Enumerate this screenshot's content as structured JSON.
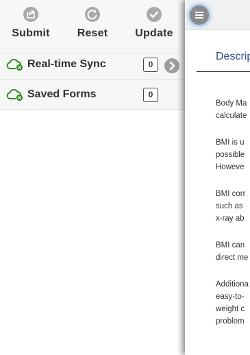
{
  "toolbar": {
    "buttons": [
      {
        "label": "Submit",
        "icon": "share-icon"
      },
      {
        "label": "Reset",
        "icon": "refresh-icon"
      },
      {
        "label": "Update",
        "icon": "checkmark-icon"
      }
    ]
  },
  "list": {
    "items": [
      {
        "label": "Real-time Sync",
        "count": "0",
        "icon": "cloud-sync-icon",
        "has_arrow": true
      },
      {
        "label": "Saved Forms",
        "count": "0",
        "icon": "cloud-sync-icon",
        "has_arrow": false
      }
    ]
  },
  "right_panel": {
    "tab_label": "Descrip",
    "paragraphs": [
      [
        "Body Ma",
        "calculate"
      ],
      [
        "BMI is u",
        "possible",
        "Howeve"
      ],
      [
        "BMI corr",
        "such as",
        "x-ray ab"
      ],
      [
        "BMI can",
        "direct me"
      ],
      [
        "Additiona",
        "easy-to-",
        "weight c",
        "problem"
      ]
    ]
  },
  "colors": {
    "icon_gray": "#a9a9a9",
    "cloud_green": "#2e8b1f",
    "link_blue": "#2a4e8f",
    "focus_glow": "#7fb6ea"
  }
}
